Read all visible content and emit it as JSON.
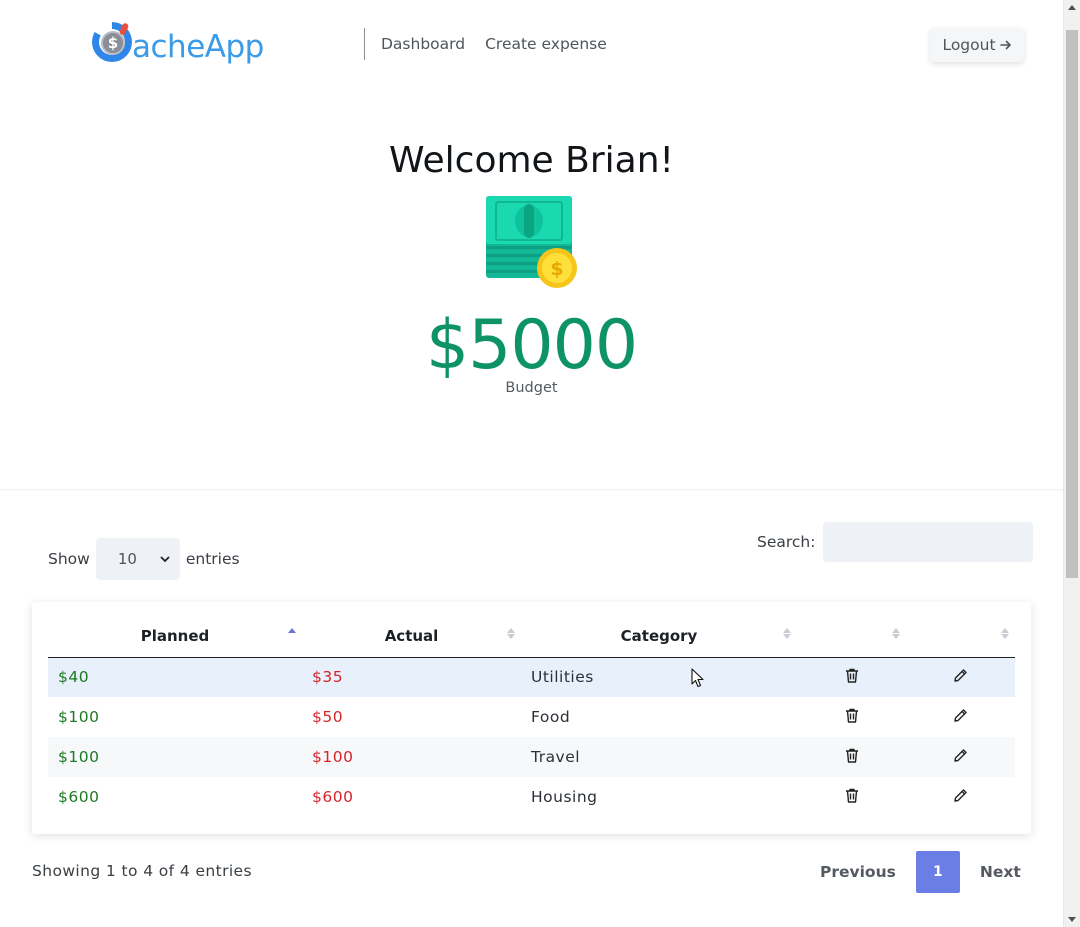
{
  "header": {
    "logo_text": "acheApp",
    "logo_coin": "$",
    "nav": [
      {
        "label": "Dashboard"
      },
      {
        "label": "Create expense"
      }
    ],
    "logout_label": "Logout",
    "logout_icon": "arrow-right-icon"
  },
  "hero": {
    "welcome": "Welcome Brian!",
    "icon": "money-bills-coin-icon",
    "budget_amount": "$5000",
    "budget_label": "Budget"
  },
  "table_controls": {
    "show_label": "Show",
    "page_length": "10",
    "entries_label": "entries",
    "search_label": "Search:",
    "search_value": ""
  },
  "table": {
    "columns": [
      {
        "label": "Planned",
        "sort": "ascending"
      },
      {
        "label": "Actual",
        "sort": "none"
      },
      {
        "label": "Category",
        "sort": "none"
      },
      {
        "label": "",
        "sort": "none"
      },
      {
        "label": "",
        "sort": "none"
      }
    ],
    "rows": [
      {
        "planned": "$40",
        "actual": "$35",
        "category": "Utilities"
      },
      {
        "planned": "$100",
        "actual": "$50",
        "category": "Food"
      },
      {
        "planned": "$100",
        "actual": "$100",
        "category": "Travel"
      },
      {
        "planned": "$600",
        "actual": "$600",
        "category": "Housing"
      }
    ],
    "row_actions": [
      "trash-icon",
      "pencil-icon"
    ]
  },
  "footer": {
    "info": "Showing 1 to 4 of 4 entries",
    "previous_label": "Previous",
    "current_page": "1",
    "next_label": "Next"
  },
  "colors": {
    "budget_green": "#0e9368",
    "planned_green": "#1b7a22",
    "actual_red": "#d6242a",
    "pager_accent": "#6b7ee6",
    "logo_blue": "#3b9be8"
  }
}
